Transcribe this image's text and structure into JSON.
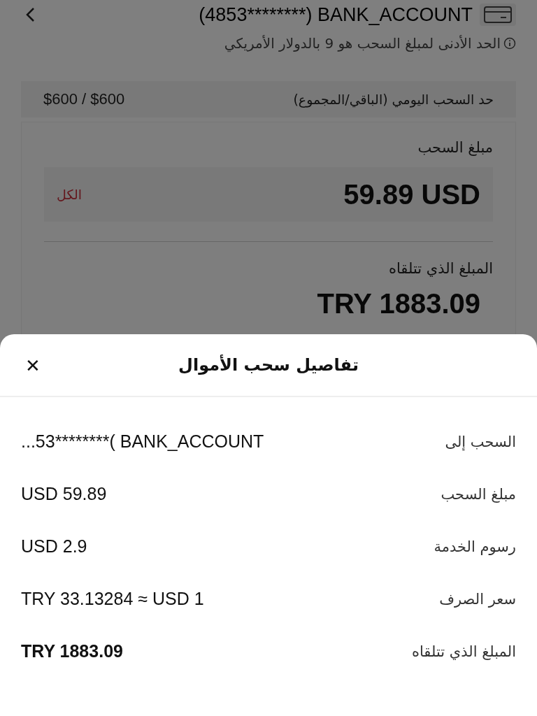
{
  "header": {
    "account": "(4853********) BANK_ACCOUNT"
  },
  "note": "الحد الأدنى لمبلغ السحب هو 9 بالدولار الأمريكي",
  "daily_limit": {
    "label": "حد السحب اليومي (الباقي/المجموع)",
    "value": "$600 / $600"
  },
  "amount": {
    "label": "مبلغ السحب",
    "value": "59.89 USD",
    "all_link": "الكل"
  },
  "receive": {
    "label": "المبلغ الذي تتلقاه",
    "value": "TRY 1883.09"
  },
  "sheet": {
    "title": "تفاصيل سحب الأموال",
    "close": "✕",
    "rows": [
      {
        "label": "السحب إلى",
        "value": "...53********( BANK_ACCOUNT",
        "bold": false
      },
      {
        "label": "مبلغ السحب",
        "value": "USD 59.89",
        "bold": false
      },
      {
        "label": "رسوم الخدمة",
        "value": "USD 2.9",
        "bold": false
      },
      {
        "label": "سعر الصرف",
        "value": "TRY 33.13284 ≈ USD 1",
        "bold": false
      },
      {
        "label": "المبلغ الذي تتلقاه",
        "value": "TRY 1883.09",
        "bold": true
      }
    ]
  }
}
